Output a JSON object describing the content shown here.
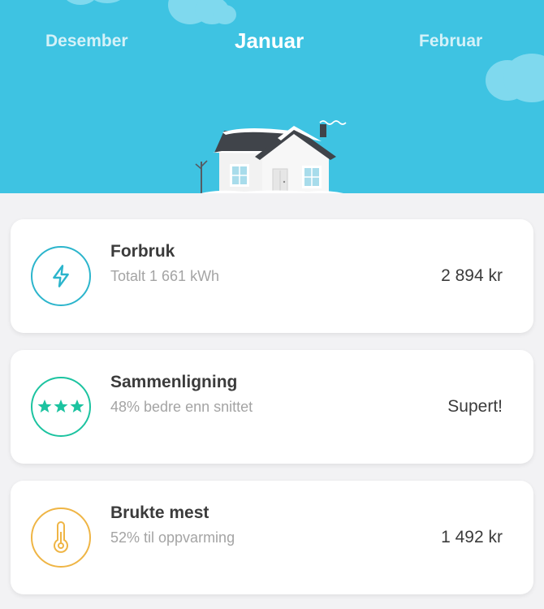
{
  "header": {
    "prev_month": "Desember",
    "current_month": "Januar",
    "next_month": "Februar"
  },
  "colors": {
    "sky": "#3ec3e2",
    "consumption_accent": "#2cb5cc",
    "comparison_accent": "#1cc3a0",
    "usage_accent": "#efb545"
  },
  "cards": [
    {
      "title": "Forbruk",
      "subtitle": "Totalt 1 661 kWh",
      "value": "2 894 kr",
      "icon": "lightning-icon"
    },
    {
      "title": "Sammenligning",
      "subtitle": "48% bedre enn snittet",
      "value": "Supert!",
      "icon": "three-stars-icon",
      "rating_stars": 3
    },
    {
      "title": "Brukte mest",
      "subtitle": "52% til oppvarming",
      "value": "1 492 kr",
      "icon": "thermometer-icon"
    }
  ]
}
